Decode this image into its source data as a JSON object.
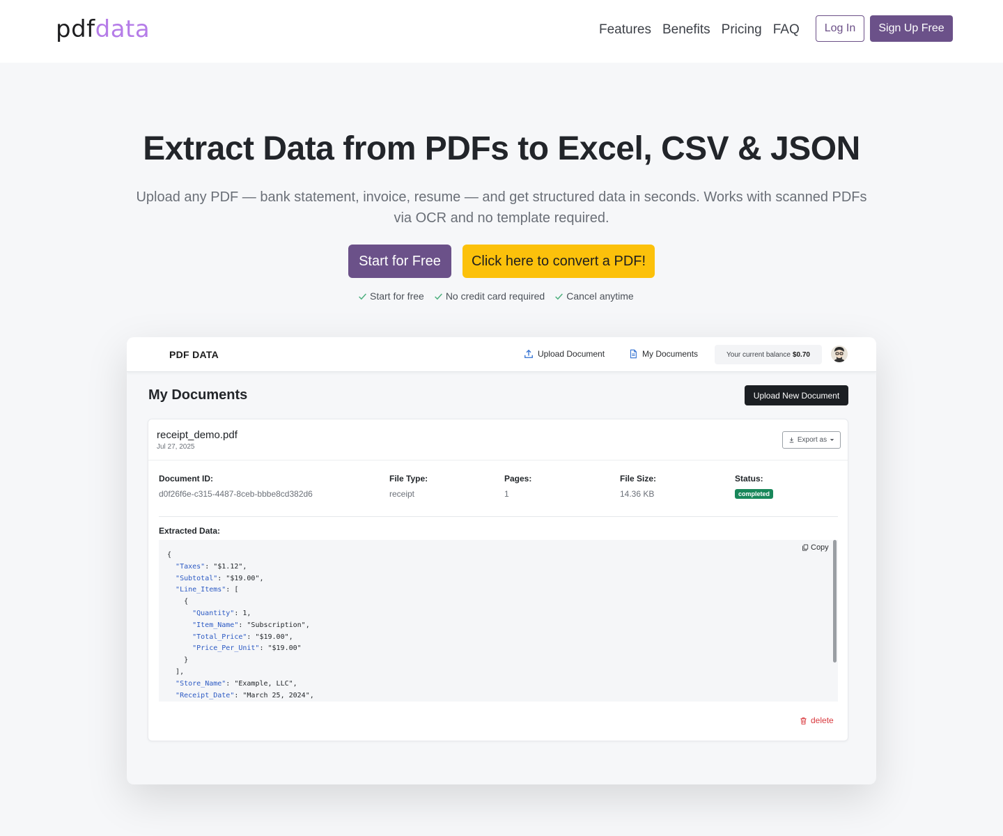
{
  "nav": {
    "logo_part1": "pdf",
    "logo_part2": "data",
    "links": [
      "Features",
      "Benefits",
      "Pricing",
      "FAQ"
    ],
    "login_label": "Log In",
    "signup_label": "Sign Up Free"
  },
  "hero": {
    "title": "Extract Data from PDFs to Excel, CSV & JSON",
    "subtitle": "Upload any PDF — bank statement, invoice, resume — and get structured data in seconds. Works with scanned PDFs via OCR and no template required.",
    "start_label": "Start for Free",
    "convert_label": "Click here to convert a PDF!",
    "checks": [
      "Start for free",
      "No credit card required",
      "Cancel anytime"
    ]
  },
  "app": {
    "brand": "PDF DATA",
    "upload_link": "Upload Document",
    "mydocs_link": "My Documents",
    "balance_label": "Your current balance",
    "balance_value": "$0.70",
    "page_title": "My Documents",
    "upload_new_label": "Upload New Document",
    "document": {
      "name": "receipt_demo.pdf",
      "date": "Jul 27, 2025",
      "export_label": "Export as",
      "id_label": "Document ID:",
      "id_value": "d0f26f6e-c315-4487-8ceb-bbbe8cd382d6",
      "type_label": "File Type:",
      "type_value": "receipt",
      "pages_label": "Pages:",
      "pages_value": "1",
      "size_label": "File Size:",
      "size_value": "14.36 KB",
      "status_label": "Status:",
      "status_value": "completed",
      "extracted_label": "Extracted Data:",
      "copy_label": "Copy",
      "delete_label": "delete",
      "json_lines": [
        {
          "indent": 0,
          "key": "",
          "rest": "{"
        },
        {
          "indent": 1,
          "key": "\"Taxes\"",
          "rest": ": \"$1.12\","
        },
        {
          "indent": 1,
          "key": "\"Subtotal\"",
          "rest": ": \"$19.00\","
        },
        {
          "indent": 1,
          "key": "\"Line_Items\"",
          "rest": ": ["
        },
        {
          "indent": 2,
          "key": "",
          "rest": "{"
        },
        {
          "indent": 3,
          "key": "\"Quantity\"",
          "rest": ": 1,"
        },
        {
          "indent": 3,
          "key": "\"Item_Name\"",
          "rest": ": \"Subscription\","
        },
        {
          "indent": 3,
          "key": "\"Total_Price\"",
          "rest": ": \"$19.00\","
        },
        {
          "indent": 3,
          "key": "\"Price_Per_Unit\"",
          "rest": ": \"$19.00\""
        },
        {
          "indent": 2,
          "key": "",
          "rest": "}"
        },
        {
          "indent": 1,
          "key": "",
          "rest": "],"
        },
        {
          "indent": 1,
          "key": "\"Store_Name\"",
          "rest": ": \"Example, LLC\","
        },
        {
          "indent": 1,
          "key": "\"Receipt_Date\"",
          "rest": ": \"March 25, 2024\","
        }
      ]
    }
  },
  "colors": {
    "brand_purple": "#6b5189",
    "logo_accent": "#b57ce8",
    "cta_yellow": "#fcc10b",
    "status_green": "#19875a",
    "delete_red": "#d9393e"
  }
}
